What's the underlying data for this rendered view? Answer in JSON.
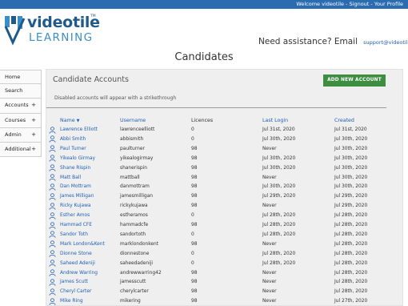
{
  "topbar": {
    "welcome": "Welcome videotile",
    "separator1": " - ",
    "signout": "Signout",
    "separator2": " - ",
    "profile": "Your Profile"
  },
  "brand": {
    "name": "videotile",
    "tagline": "LEARNING",
    "tm": "TM"
  },
  "assist": {
    "question": "Need assistance? Email",
    "email": "support@videotile.co.uk"
  },
  "page": {
    "title": "Candidates"
  },
  "sidebar": {
    "items": [
      {
        "label": "Home",
        "expand": ""
      },
      {
        "label": "Search",
        "expand": ""
      },
      {
        "label": "Accounts",
        "expand": "+"
      },
      {
        "label": "Courses",
        "expand": "+"
      },
      {
        "label": "Admin",
        "expand": "+"
      },
      {
        "label": "Additional",
        "expand": "+"
      }
    ]
  },
  "panel": {
    "heading": "Candidate Accounts",
    "add_button": "ADD NEW ACCOUNT",
    "note": "Disabled accounts will appear with a strikethrough"
  },
  "table": {
    "columns": {
      "name": "Name",
      "username": "Username",
      "licences": "Licences",
      "last_login": "Last Login",
      "created": "Created"
    },
    "rows": [
      {
        "name": "Lawrence Elliott",
        "username": "lawrenceelliott",
        "licences": "0",
        "last_login": "Jul 31st, 2020",
        "created": "Jul 31st, 2020"
      },
      {
        "name": "Abbi Smith",
        "username": "abbismith",
        "licences": "0",
        "last_login": "Jul 30th, 2020",
        "created": "Jul 30th, 2020"
      },
      {
        "name": "Paul Turner",
        "username": "paulturner",
        "licences": "98",
        "last_login": "Never",
        "created": "Jul 30th, 2020"
      },
      {
        "name": "Yikealo Girmay",
        "username": "yikealogirmay",
        "licences": "98",
        "last_login": "Jul 30th, 2020",
        "created": "Jul 30th, 2020"
      },
      {
        "name": "Shane Rispin",
        "username": "shanerispin",
        "licences": "98",
        "last_login": "Jul 30th, 2020",
        "created": "Jul 30th, 2020"
      },
      {
        "name": "Matt Ball",
        "username": "mattball",
        "licences": "98",
        "last_login": "Never",
        "created": "Jul 30th, 2020"
      },
      {
        "name": "Dan Mottram",
        "username": "danmottram",
        "licences": "98",
        "last_login": "Jul 30th, 2020",
        "created": "Jul 30th, 2020"
      },
      {
        "name": "James Milligan",
        "username": "jamesmilligan",
        "licences": "98",
        "last_login": "Jul 29th, 2020",
        "created": "Jul 29th, 2020"
      },
      {
        "name": "Ricky Kujawa",
        "username": "rickykujawa",
        "licences": "98",
        "last_login": "Never",
        "created": "Jul 29th, 2020"
      },
      {
        "name": "Esther Amos",
        "username": "estheramos",
        "licences": "0",
        "last_login": "Jul 28th, 2020",
        "created": "Jul 28th, 2020"
      },
      {
        "name": "Hammad CFE",
        "username": "hammadcfe",
        "licences": "98",
        "last_login": "Jul 28th, 2020",
        "created": "Jul 28th, 2020"
      },
      {
        "name": "Sandor Toth",
        "username": "sandortoth",
        "licences": "0",
        "last_login": "Jul 28th, 2020",
        "created": "Jul 28th, 2020"
      },
      {
        "name": "Mark London&Kent",
        "username": "marklondonkent",
        "licences": "98",
        "last_login": "Never",
        "created": "Jul 28th, 2020"
      },
      {
        "name": "Dionne Stone",
        "username": "dionnestone",
        "licences": "0",
        "last_login": "Jul 28th, 2020",
        "created": "Jul 28th, 2020"
      },
      {
        "name": "Saheed Adeniji",
        "username": "saheedadeniji",
        "licences": "0",
        "last_login": "Jul 28th, 2020",
        "created": "Jul 28th, 2020"
      },
      {
        "name": "Andrew Warring",
        "username": "andrewwarring42",
        "licences": "98",
        "last_login": "Never",
        "created": "Jul 28th, 2020"
      },
      {
        "name": "James Scutt",
        "username": "jamesscutt",
        "licences": "98",
        "last_login": "Never",
        "created": "Jul 28th, 2020"
      },
      {
        "name": "Cheryl Carter",
        "username": "cherylcarter",
        "licences": "98",
        "last_login": "Never",
        "created": "Jul 28th, 2020"
      },
      {
        "name": "Mike Ring",
        "username": "mikering",
        "licences": "98",
        "last_login": "Never",
        "created": "Jul 27th, 2020"
      }
    ]
  },
  "colors": {
    "topbar": "#2b6cb0",
    "link": "#1f5fb4",
    "add_button": "#3e8e41",
    "panel": "#efefef",
    "brand": "#1f5a8a"
  },
  "icons": {
    "user": "user-icon",
    "sort": "sort-desc-icon",
    "logo": "logo-mark-icon"
  }
}
